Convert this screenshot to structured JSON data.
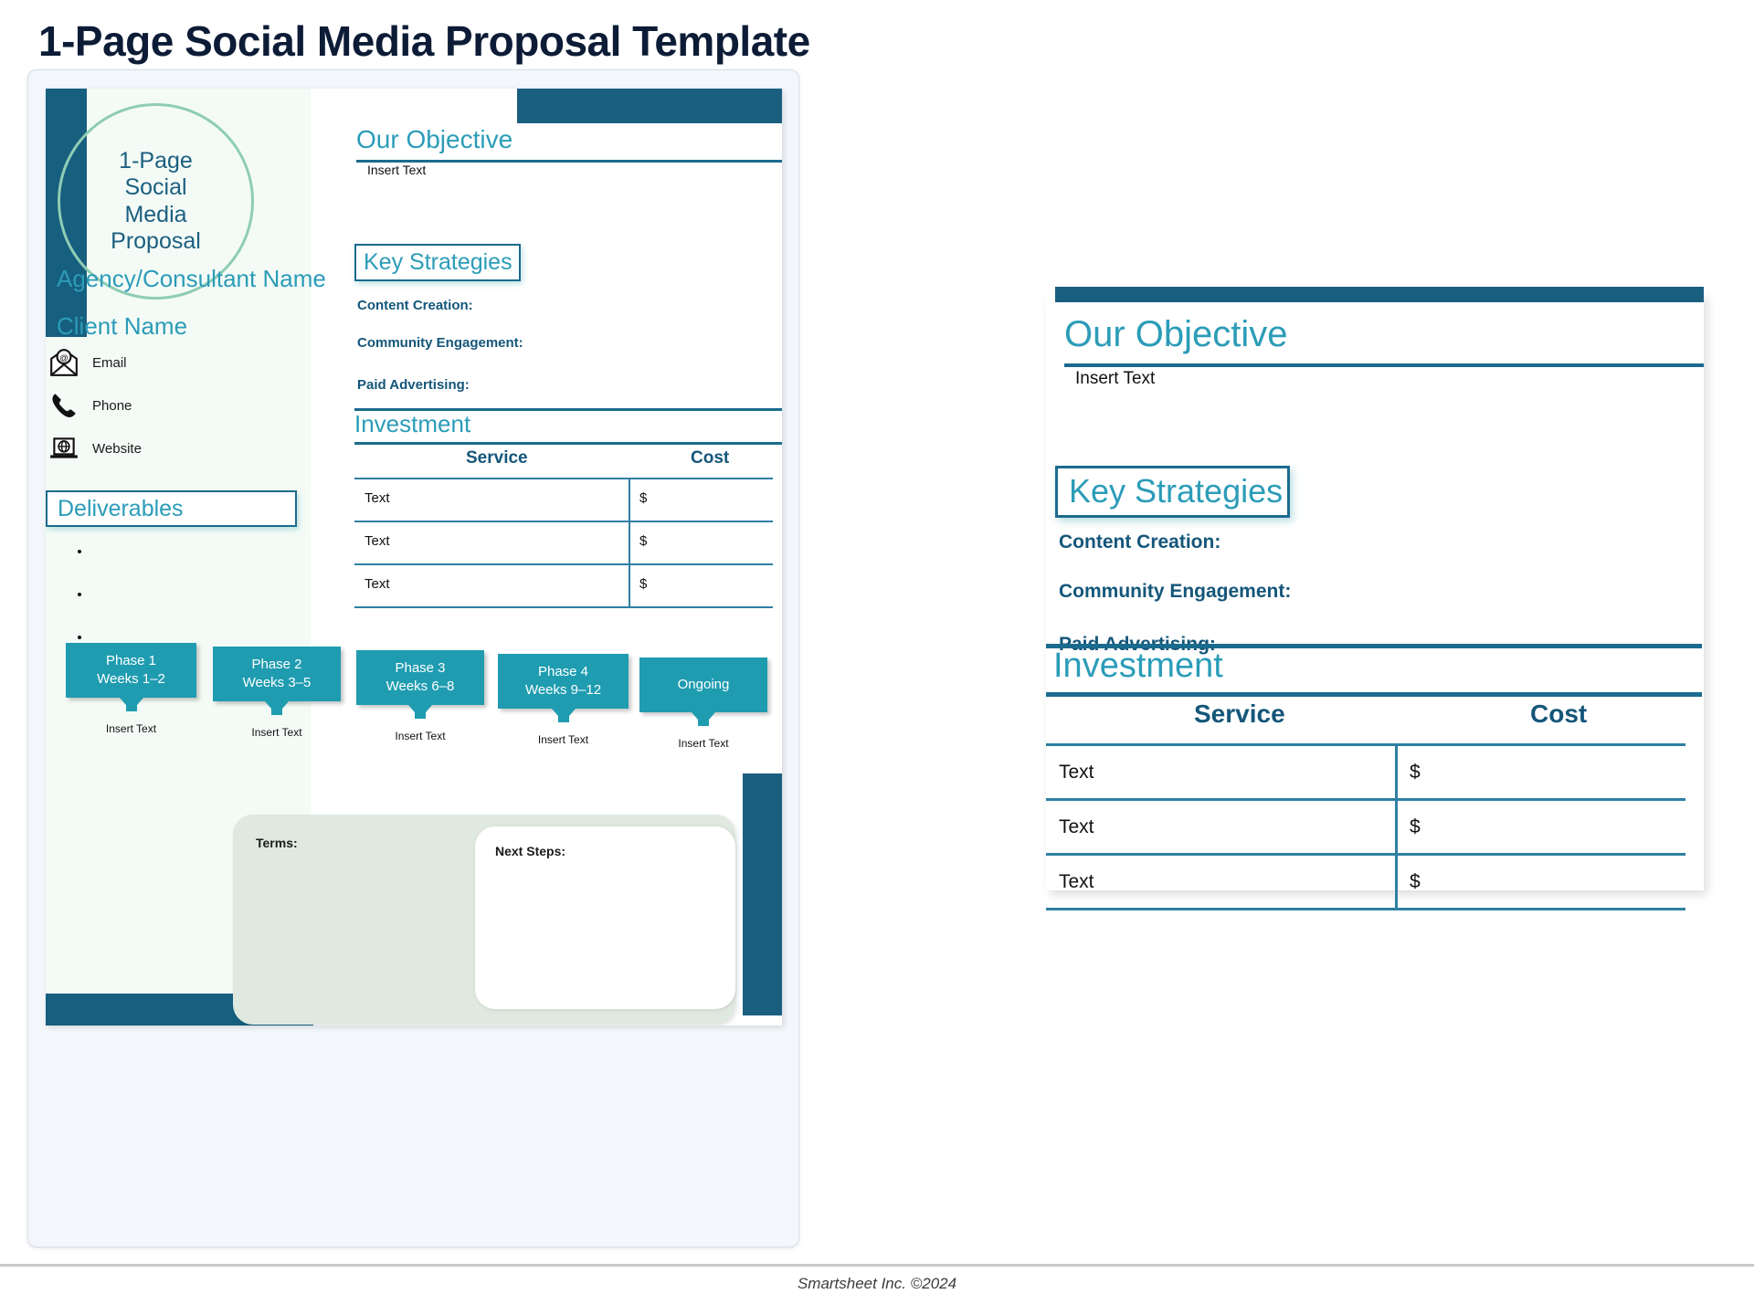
{
  "page_title": "1-Page Social Media Proposal Template",
  "footer": "Smartsheet Inc. ©2024",
  "colors": {
    "dark_teal": "#1b5f80",
    "accent_teal": "#2b9cb8",
    "phase_teal": "#1f9cb0",
    "heading_navy": "#14567a",
    "mint_bg": "#f4fbf6",
    "terms_bg": "#dfe9e0",
    "circle_stroke": "#8fcdb5",
    "title_navy": "#0d1c36"
  },
  "document": {
    "logo_text": "1-Page\nSocial\nMedia\nProposal",
    "agency_name": "Agency/Consultant Name",
    "client_name": "Client Name",
    "contacts": [
      {
        "icon": "email-icon",
        "label": "Email"
      },
      {
        "icon": "phone-icon",
        "label": "Phone"
      },
      {
        "icon": "website-icon",
        "label": "Website"
      }
    ],
    "deliverables": {
      "title": "Deliverables",
      "bullets": [
        "",
        "",
        ""
      ]
    },
    "objective": {
      "title": "Our Objective",
      "body": "Insert Text"
    },
    "key_strategies": {
      "title": "Key Strategies",
      "items": [
        "Content Creation:",
        "Community Engagement:",
        "Paid Advertising:"
      ]
    },
    "investment": {
      "title": "Investment",
      "columns": [
        "Service",
        "Cost"
      ],
      "rows": [
        {
          "service": "Text",
          "cost": "$"
        },
        {
          "service": "Text",
          "cost": "$"
        },
        {
          "service": "Text",
          "cost": "$"
        }
      ]
    },
    "phases": [
      {
        "label": "Phase 1\nWeeks 1–2",
        "caption": "Insert Text"
      },
      {
        "label": "Phase 2\nWeeks 3–5",
        "caption": "Insert Text"
      },
      {
        "label": "Phase 3\nWeeks 6–8",
        "caption": "Insert Text"
      },
      {
        "label": "Phase 4\nWeeks 9–12",
        "caption": "Insert Text"
      },
      {
        "label": "Ongoing",
        "caption": "Insert Text"
      }
    ],
    "terms_label": "Terms:",
    "next_steps_label": "Next Steps:"
  },
  "preview_panel": {
    "objective": {
      "title": "Our Objective",
      "body": "Insert Text"
    },
    "key_strategies": {
      "title": "Key Strategies",
      "items": [
        "Content Creation:",
        "Community Engagement:",
        "Paid Advertising:"
      ]
    },
    "investment": {
      "title": "Investment",
      "columns": [
        "Service",
        "Cost"
      ],
      "rows": [
        {
          "service": "Text",
          "cost": "$"
        },
        {
          "service": "Text",
          "cost": "$"
        },
        {
          "service": "Text",
          "cost": "$"
        }
      ]
    }
  }
}
